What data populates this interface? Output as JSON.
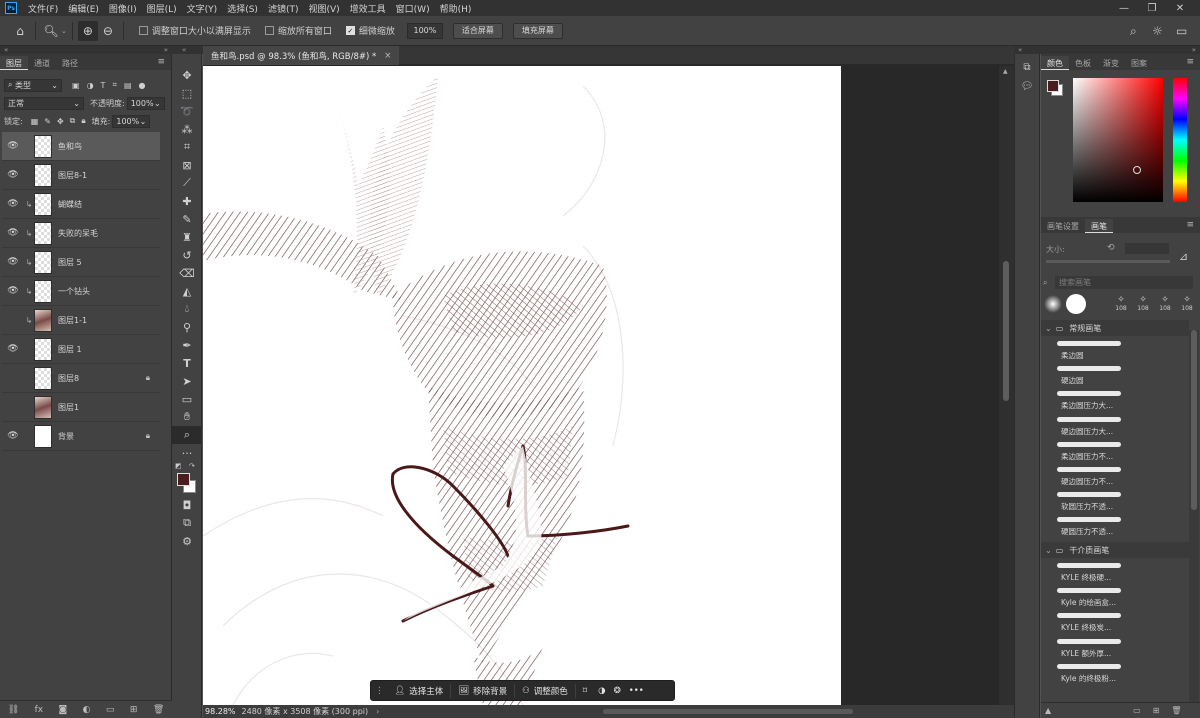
{
  "app": {
    "logo": "Ps"
  },
  "menu": [
    "文件(F)",
    "编辑(E)",
    "图像(I)",
    "图层(L)",
    "文字(Y)",
    "选择(S)",
    "滤镜(T)",
    "视图(V)",
    "增效工具",
    "窗口(W)",
    "帮助(H)"
  ],
  "options": {
    "resize_windows": "调整窗口大小以满屏显示",
    "zoom_all": "缩放所有窗口",
    "scrubby": "细微缩放",
    "zoom_value": "100%",
    "fit_screen": "适合屏幕",
    "fill_screen": "填充屏幕"
  },
  "layers_panel": {
    "tabs": [
      "图层",
      "通道",
      "路径"
    ],
    "filter_kind": "类型",
    "blend_mode": "正常",
    "opacity_label": "不透明度:",
    "opacity_value": "100%",
    "lock_label": "锁定:",
    "fill_label": "填充:",
    "fill_value": "100%",
    "items": [
      {
        "name": "鱼和鸟",
        "visible": true,
        "clipped": false,
        "thumb": "checker",
        "locked": false,
        "selected": true
      },
      {
        "name": "图层8-1",
        "visible": true,
        "clipped": false,
        "thumb": "checker",
        "locked": false
      },
      {
        "name": "蝴蝶结",
        "visible": true,
        "clipped": true,
        "thumb": "checker",
        "locked": false
      },
      {
        "name": "失败的呆毛",
        "visible": true,
        "clipped": true,
        "thumb": "checker",
        "locked": false
      },
      {
        "name": "图层 5",
        "visible": true,
        "clipped": true,
        "thumb": "checker",
        "locked": false
      },
      {
        "name": "一个钻头",
        "visible": true,
        "clipped": true,
        "thumb": "checker",
        "locked": false
      },
      {
        "name": "图层1-1",
        "visible": false,
        "clipped": true,
        "thumb": "image",
        "locked": false
      },
      {
        "name": "图层 1",
        "visible": true,
        "clipped": false,
        "thumb": "checker",
        "locked": false
      },
      {
        "name": "图层8",
        "visible": false,
        "clipped": false,
        "thumb": "checker",
        "locked": true
      },
      {
        "name": "图层1",
        "visible": false,
        "clipped": false,
        "thumb": "image",
        "locked": false
      },
      {
        "name": "背景",
        "visible": true,
        "clipped": false,
        "thumb": "white",
        "locked": true
      }
    ]
  },
  "document": {
    "tab_title": "鱼和鸟.psd @ 98.3% (鱼和鸟, RGB/8#) *",
    "zoom_status": "98.28%",
    "size_status": "2480 像素 x 3508 像素 (300 ppi)"
  },
  "context_bar": {
    "select_subject": "选择主体",
    "remove_bg": "移除背景",
    "adjust_color": "调整颜色"
  },
  "right_panel": {
    "color_tabs": [
      "颜色",
      "色板",
      "渐变",
      "图案"
    ],
    "foreground_color": "#4a1e1e",
    "brush_tabs": [
      "画笔设置",
      "画笔"
    ],
    "size_label": "大小:",
    "search_placeholder": "搜索画笔",
    "tip_sizes": [
      "108",
      "108",
      "108",
      "108"
    ],
    "group1": "常规画笔",
    "group1_brushes": [
      "柔边圆",
      "硬边圆",
      "柔边圆压力大...",
      "硬边圆压力大...",
      "柔边圆压力不...",
      "硬边圆压力不...",
      "软圆压力不透...",
      "硬圆压力不透..."
    ],
    "group2": "干介质画笔",
    "group2_brushes": [
      "KYLE 终极硬...",
      "Kyle 的绘画盒...",
      "KYLE 终极炭...",
      "KYLE 额外厚...",
      "Kyle 的终极粉..."
    ]
  }
}
